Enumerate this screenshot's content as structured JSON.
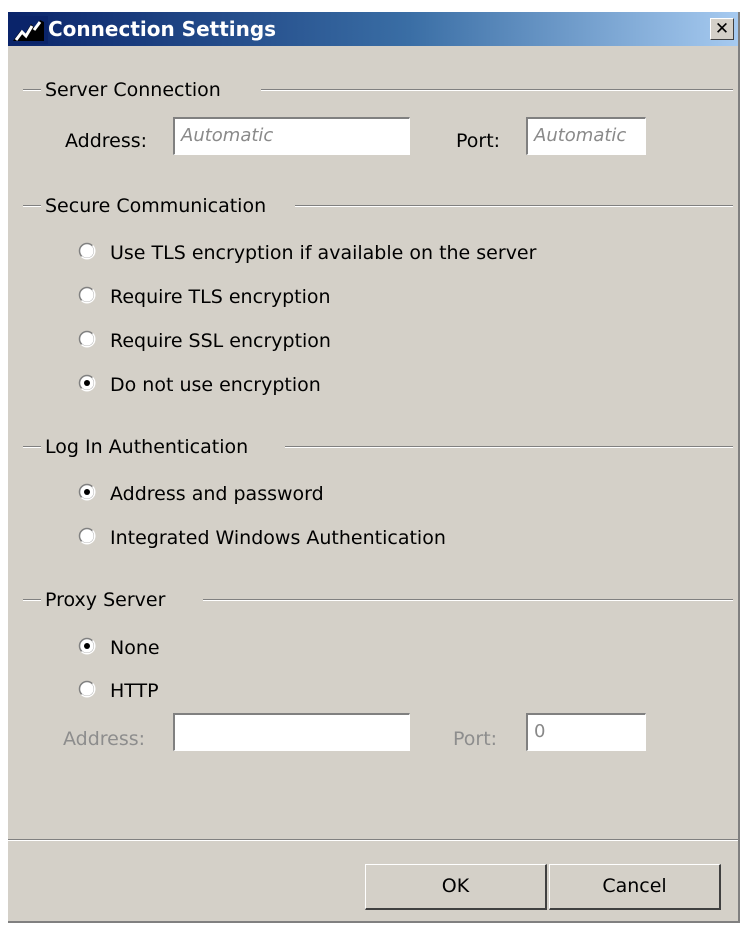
{
  "window": {
    "title": "Connection Settings",
    "close_glyph": "✕"
  },
  "server_connection": {
    "heading": "Server Connection",
    "address_label": "Address:",
    "address_value": "Automatic",
    "port_label": "Port:",
    "port_value": "Automatic"
  },
  "secure_communication": {
    "heading": "Secure Communication",
    "options": [
      {
        "label": "Use TLS encryption if available on the server",
        "checked": false
      },
      {
        "label": "Require TLS encryption",
        "checked": false
      },
      {
        "label": "Require SSL encryption",
        "checked": false
      },
      {
        "label": "Do not use encryption",
        "checked": true
      }
    ]
  },
  "log_in_authentication": {
    "heading": "Log In Authentication",
    "options": [
      {
        "label": "Address and password",
        "checked": true
      },
      {
        "label": "Integrated Windows Authentication",
        "checked": false
      }
    ]
  },
  "proxy_server": {
    "heading": "Proxy Server",
    "options": [
      {
        "label": "None",
        "checked": true
      },
      {
        "label": "HTTP",
        "checked": false
      }
    ],
    "address_label": "Address:",
    "address_value": "",
    "port_label": "Port:",
    "port_value": "0"
  },
  "buttons": {
    "ok": "OK",
    "cancel": "Cancel"
  },
  "icons": {
    "app": "app-logo-icon",
    "close": "close-icon",
    "radio": "radio-icon"
  },
  "colors": {
    "dialog_bg": "#d4d0c8",
    "title_gradient_start": "#0a246a",
    "title_gradient_end": "#a6caf0"
  }
}
